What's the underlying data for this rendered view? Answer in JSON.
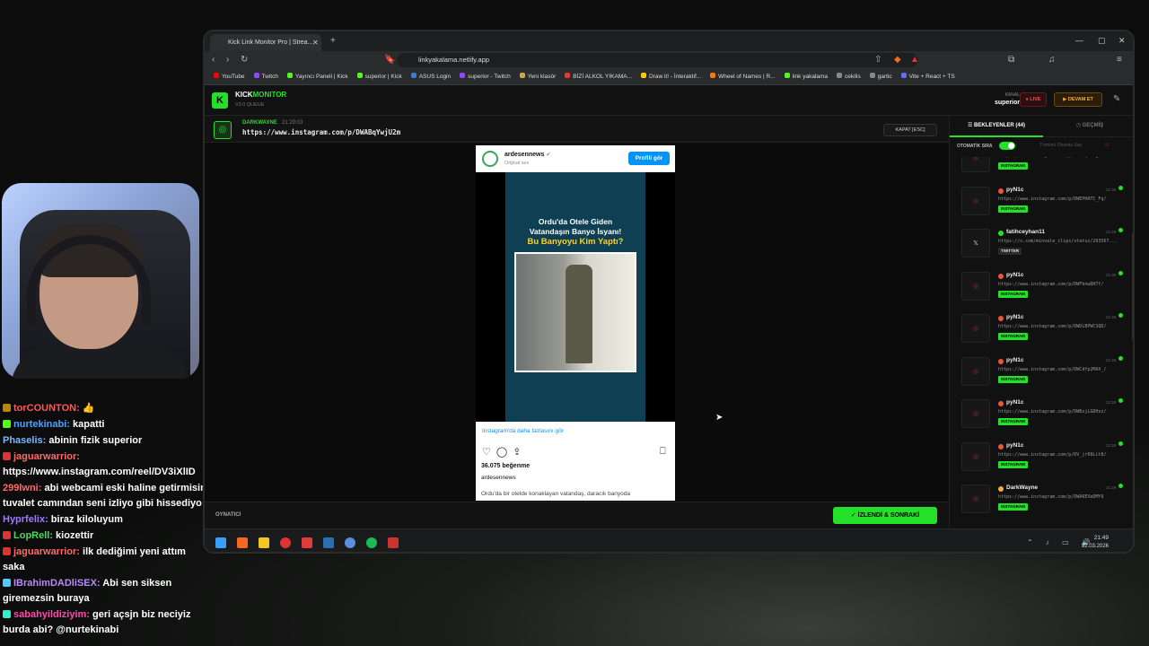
{
  "browser": {
    "tab_title": "Kick Link Monitor Pro | Strea...",
    "new_tab": "+",
    "url": "linkyakalama.netlify.app",
    "bookmarks": [
      {
        "label": "YouTube",
        "color": "#ff0000"
      },
      {
        "label": "Twitch",
        "color": "#9146ff"
      },
      {
        "label": "Yayıncı Paneli | Kick",
        "color": "#53fc18"
      },
      {
        "label": "superior | Kick",
        "color": "#53fc18"
      },
      {
        "label": "ASUS Login",
        "color": "#3a7bd5"
      },
      {
        "label": "superior - Twitch",
        "color": "#9146ff"
      },
      {
        "label": "Yeni klasör",
        "color": "#c9a94a"
      },
      {
        "label": "BİZİ ALKOL YIKAMA...",
        "color": "#e33"
      },
      {
        "label": "Draw it! - İnteraktif...",
        "color": "#ffcc00"
      },
      {
        "label": "Wheel of Names | R...",
        "color": "#ff7700"
      },
      {
        "label": "link yakalama",
        "color": "#53fc18"
      },
      {
        "label": "cekilis",
        "color": "#888"
      },
      {
        "label": "gartic",
        "color": "#888"
      },
      {
        "label": "Vite + React + TS",
        "color": "#646cff"
      }
    ]
  },
  "app": {
    "logo_letter": "K",
    "title_a": "KICK",
    "title_b": "MONITOR",
    "version": "V3.0 QUEUE",
    "channel_label": "KANAL",
    "channel_name": "superior",
    "live_label": "● LIVE",
    "continue_label": "▶ DEVAM ET",
    "current": {
      "user": "DARKWAYNE",
      "time": "21:29:03",
      "url": "https://www.instagram.com/p/DWABqYwjU2m",
      "close_label": "KAPAT [ESC]"
    },
    "footer": {
      "player_label": "OYNATICI",
      "next_label": "✓ İZLENDİ & SONRAKİ"
    },
    "sidebar": {
      "tab_waiting": "☰ BEKLEYENLER (44)",
      "tab_history": "◷ GEÇMİŞ",
      "auto_queue": "OTOMATİK SIRA",
      "mark_all": "Tümünü Okundu Say",
      "delete_all": "Sil"
    },
    "queue": [
      {
        "user": "",
        "time": "",
        "url": "https://www.instagram.com/p/DWcFqFbCgUb/",
        "tag": "INSTAGRAM",
        "type": "ig"
      },
      {
        "user": "pyN1c",
        "time": "21:30",
        "url": "https://www.instagram.com/p/DWEPHATC_Fq/",
        "tag": "INSTAGRAM",
        "type": "ig"
      },
      {
        "user": "fatihceyhan11",
        "time": "21:29",
        "url": "https://x.com/minvale_clips/status/203567...",
        "tag": "TWITTER",
        "type": "tw"
      },
      {
        "user": "pyN1c",
        "time": "21:30",
        "url": "https://www.instagram.com/p/DWFbnwQH7f/",
        "tag": "INSTAGRAM",
        "type": "ig"
      },
      {
        "user": "pyN1c",
        "time": "21:29",
        "url": "https://www.instagram.com/p/DWDLBPWCSQD/",
        "tag": "INSTAGRAM",
        "type": "ig"
      },
      {
        "user": "pyN1c",
        "time": "21:29",
        "url": "https://www.instagram.com/p/DWCdfp2MAX_/",
        "tag": "INSTAGRAM",
        "type": "ig"
      },
      {
        "user": "pyN1c",
        "time": "21:29",
        "url": "https://www.instagram.com/p/DWBzjLGDHzz/",
        "tag": "INSTAGRAM",
        "type": "ig"
      },
      {
        "user": "pyN1c",
        "time": "21:29",
        "url": "https://www.instagram.com/p/DV_jr68Lit8/",
        "tag": "INSTAGRAM",
        "type": "ig"
      },
      {
        "user": "DarkWayne",
        "time": "21:29",
        "url": "https://www.instagram.com/p/DWA6EXeDMY9",
        "tag": "INSTAGRAM",
        "type": "ig"
      }
    ]
  },
  "instagram": {
    "account": "ardesennews",
    "verified": "✔",
    "sub": "Orijinal ses",
    "profile_button": "Profili gör",
    "title1": "Ordu'da Otele Giden",
    "title2": "Vatandaşın Banyo İsyanı!",
    "title3": "Bu Banyoyu Kim Yaptı?",
    "more_link": "Instagram'da daha fazlasını gör",
    "likes": "36.075 beğenme",
    "caption_user": "ardesennews",
    "caption": "Ordu'da bir otelde konaklayan vatandaş, daracık banyoda"
  },
  "taskbar": {
    "time": "21:49",
    "date": "22.03.2026"
  },
  "chat": [
    {
      "user": "torCOUNTON:",
      "text": " 👍",
      "color": "#ff5a5a",
      "badge": "#b8860b"
    },
    {
      "user": "nurtekinabi:",
      "text": " kapatti",
      "color": "#4aa3ff",
      "badge": "#53fc18"
    },
    {
      "user": "Phaselis:",
      "text": " abinin fizik superior",
      "color": "#7ab8ff",
      "badge": ""
    },
    {
      "user": "jaguarwarrior:",
      "text": " https://www.instagram.com/reel/DV3iXlID",
      "color": "#ff6a6a",
      "badge": "#d33"
    },
    {
      "user": "299lwni:",
      "text": " abi webcami eski haline getirmisin tuvalet camından seni izliyo gibi hissediyo",
      "color": "#ff6a6a",
      "badge": ""
    },
    {
      "user": "Hyprfelix:",
      "text": " biraz kiloluyum",
      "color": "#a07aff",
      "badge": ""
    },
    {
      "user": "LopRell:",
      "text": " kiozettir",
      "color": "#4cd964",
      "badge": "#d33"
    },
    {
      "user": "jaguarwarrior:",
      "text": " ilk dediğimi yeni attım saka",
      "color": "#ff6a6a",
      "badge": "#d33"
    },
    {
      "user": "IBrahimDADliSEX:",
      "text": " Abi sen siksen giremezsin buraya",
      "color": "#b98aff",
      "badge": "#53c8ff"
    },
    {
      "user": "sabahyildiziyim:",
      "text": " geri açsjn biz neciyiz burda abi? @nurtekinabi",
      "color": "#ff4ab0",
      "badge": "#3ec"
    }
  ]
}
